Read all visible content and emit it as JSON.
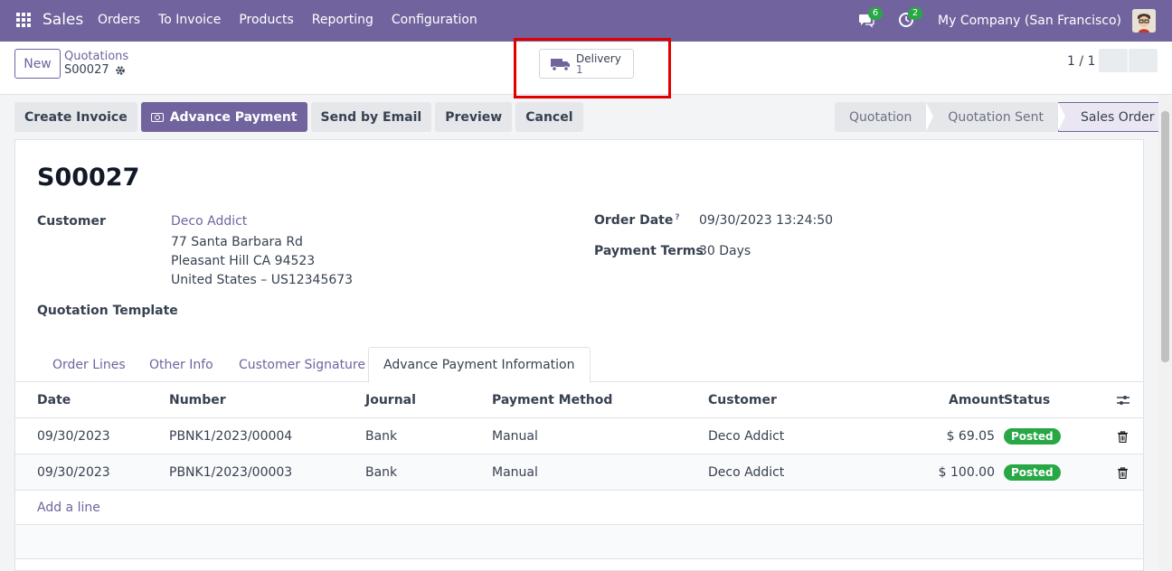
{
  "navbar": {
    "app_name": "Sales",
    "menu": [
      "Orders",
      "To Invoice",
      "Products",
      "Reporting",
      "Configuration"
    ],
    "messages_count": "6",
    "activities_count": "2",
    "company": "My Company (San Francisco)"
  },
  "control": {
    "new_label": "New",
    "breadcrumb": "Quotations",
    "record": "S00027",
    "smart_button": {
      "label": "Delivery",
      "value": "1",
      "icon": "truck-icon"
    },
    "pager": "1 / 1"
  },
  "actions": [
    "Create Invoice",
    "Advance Payment",
    "Send by Email",
    "Preview",
    "Cancel"
  ],
  "statusbar": [
    "Quotation",
    "Quotation Sent",
    "Sales Order"
  ],
  "form": {
    "title": "S00027",
    "customer_label": "Customer",
    "customer_name": "Deco Addict",
    "address_line1": "77 Santa Barbara Rd",
    "address_line2": "Pleasant Hill CA 94523",
    "address_line3": "United States – US12345673",
    "template_label": "Quotation Template",
    "order_date_label": "Order Date",
    "order_date_help": "?",
    "order_date": "09/30/2023 13:24:50",
    "payment_terms_label": "Payment Terms",
    "payment_terms": "30 Days"
  },
  "tabs": [
    "Order Lines",
    "Other Info",
    "Customer Signature",
    "Advance Payment Information"
  ],
  "table": {
    "headers": [
      "Date",
      "Number",
      "Journal",
      "Payment Method",
      "Customer",
      "Amount",
      "Status"
    ],
    "rows": [
      [
        "09/30/2023",
        "PBNK1/2023/00004",
        "Bank",
        "Manual",
        "Deco Addict",
        "$ 69.05",
        "Posted"
      ],
      [
        "09/30/2023",
        "PBNK1/2023/00003",
        "Bank",
        "Manual",
        "Deco Addict",
        "$ 100.00",
        "Posted"
      ]
    ],
    "add_line": "Add a line"
  },
  "colors": {
    "brand": "#71639e",
    "posted": "#28a745",
    "highlight": "#e00000"
  }
}
